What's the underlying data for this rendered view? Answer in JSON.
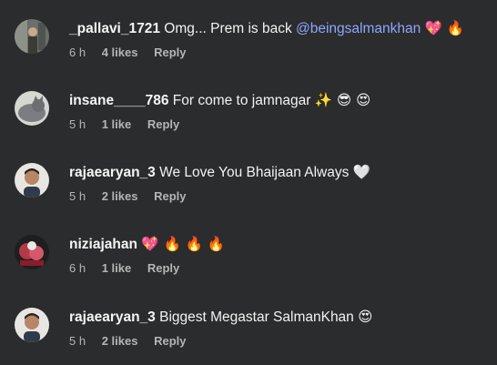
{
  "comments": [
    {
      "username": "_pallavi_1721",
      "text": "Omg... Prem is back",
      "mention": "@beingsalmankhan",
      "emoji": "💖 🔥",
      "time": "6 h",
      "likes": "4 likes",
      "reply": "Reply"
    },
    {
      "username": "insane____786",
      "text": "For come to jamnagar",
      "emoji": "✨ 😎 😍",
      "time": "5 h",
      "likes": "1 like",
      "reply": "Reply"
    },
    {
      "username": "rajaearyan_3",
      "text": "We Love You Bhaijaan Always",
      "emoji": "🤍",
      "time": "5 h",
      "likes": "2 likes",
      "reply": "Reply"
    },
    {
      "username": "niziajahan",
      "text": "",
      "emoji": "💖 🔥 🔥 🔥",
      "time": "6 h",
      "likes": "1 like",
      "reply": "Reply"
    },
    {
      "username": "rajaearyan_3",
      "text": "Biggest Megastar SalmanKhan",
      "emoji": "😍",
      "time": "5 h",
      "likes": "2 likes",
      "reply": "Reply"
    }
  ]
}
